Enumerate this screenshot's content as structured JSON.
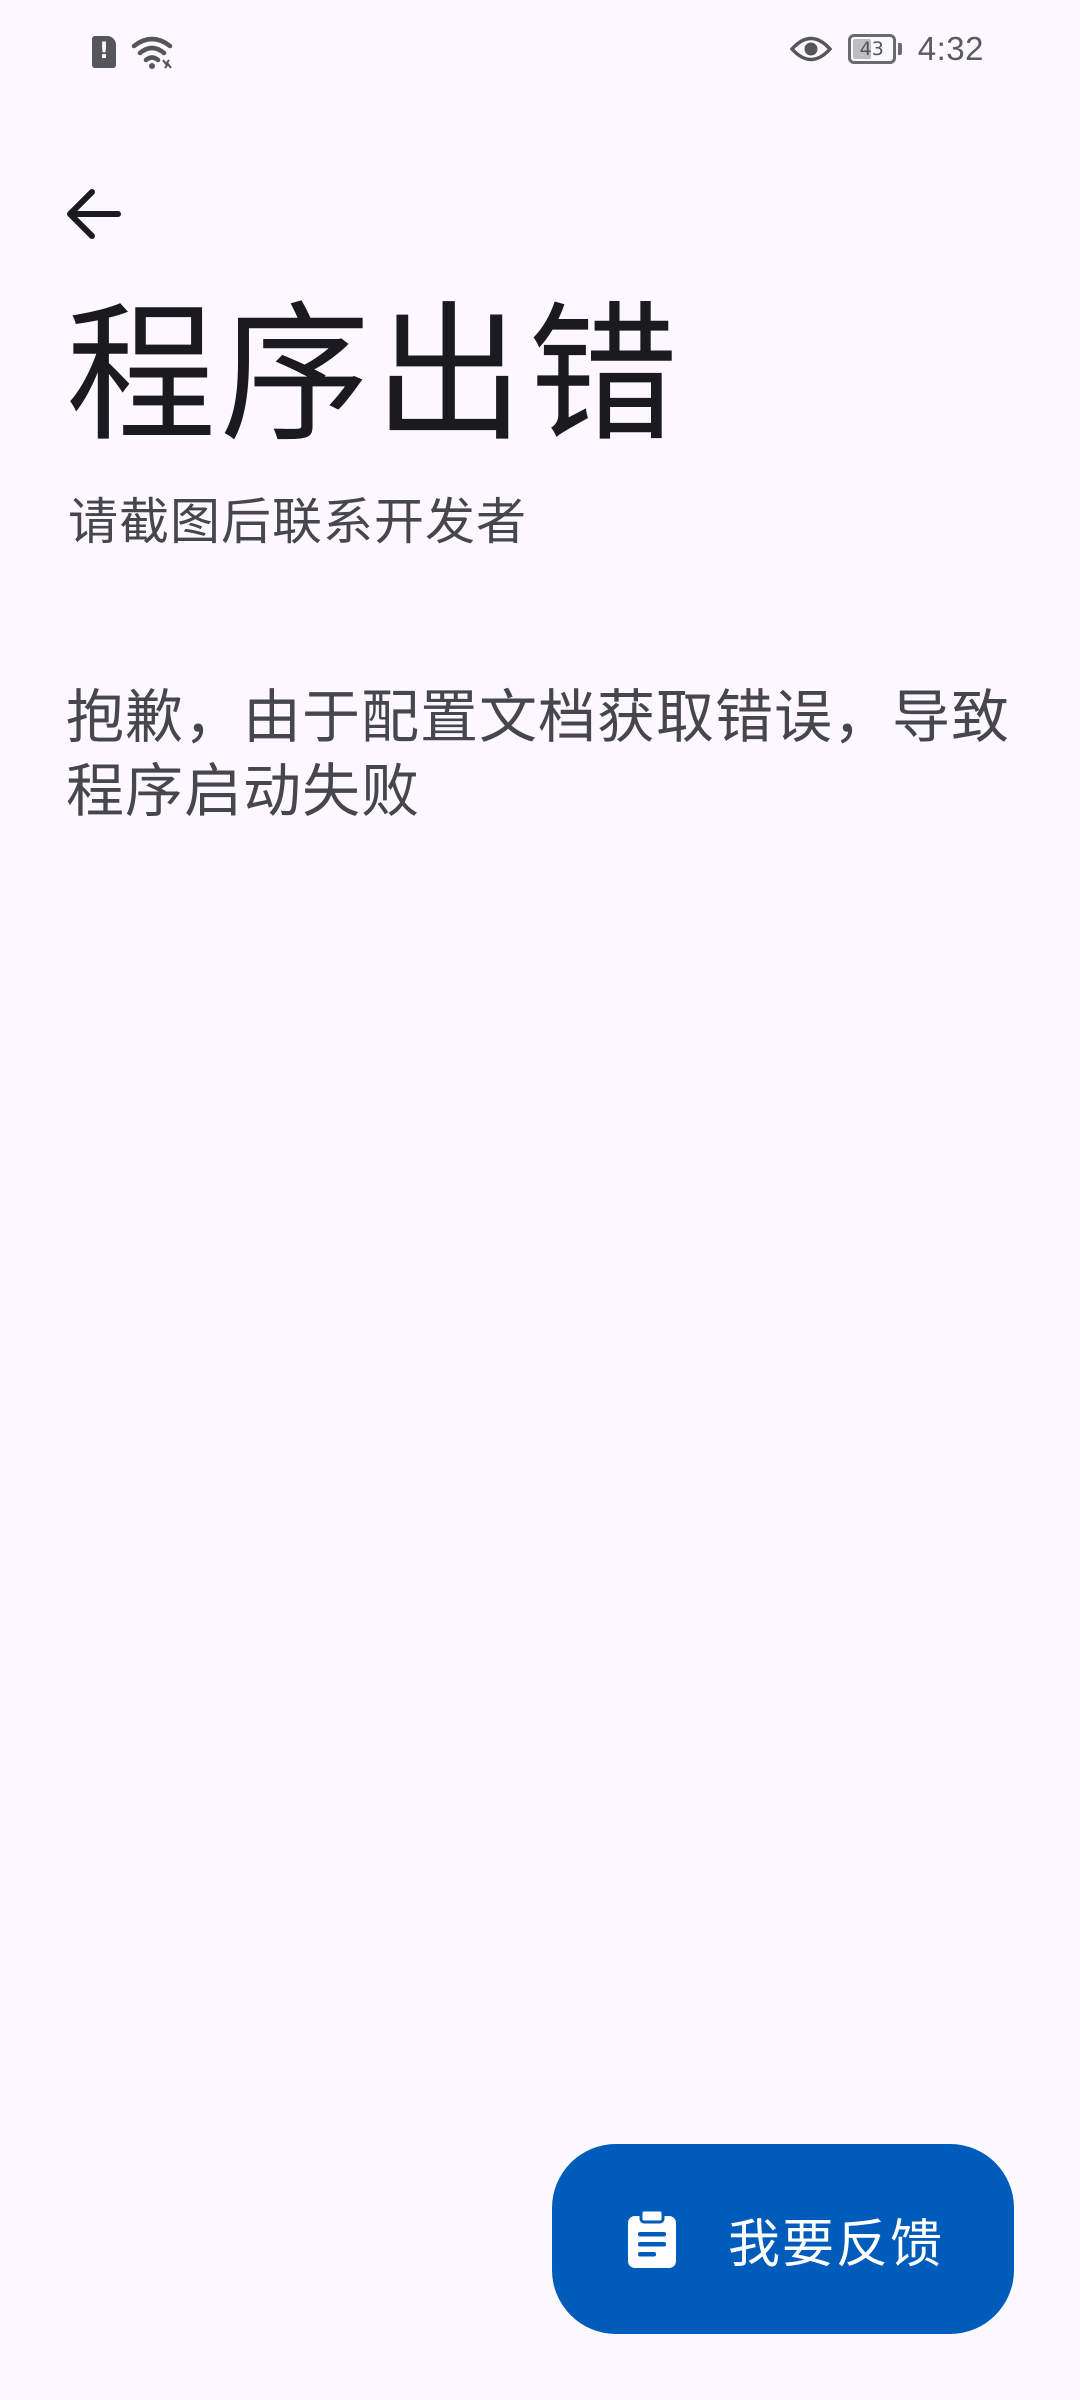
{
  "status_bar": {
    "left_icons": [
      "sim-alert-icon",
      "wifi-icon"
    ],
    "right_icons": [
      "eye-icon",
      "battery-icon"
    ],
    "sim_alert_glyph": "!",
    "battery_level": "43",
    "time": "4:32"
  },
  "nav": {
    "back_icon": "arrow-left-icon"
  },
  "content": {
    "title": "程序出错",
    "subtitle": "请截图后联系开发者",
    "message": "抱歉，由于配置文档获取错误，导致程序启动失败"
  },
  "feedback_button": {
    "icon": "clipboard-icon",
    "label": "我要反馈"
  },
  "colors": {
    "background": "#fcf8ff",
    "primary": "#005cbb",
    "title_text": "#1b1b1f",
    "body_text": "#46464b"
  }
}
